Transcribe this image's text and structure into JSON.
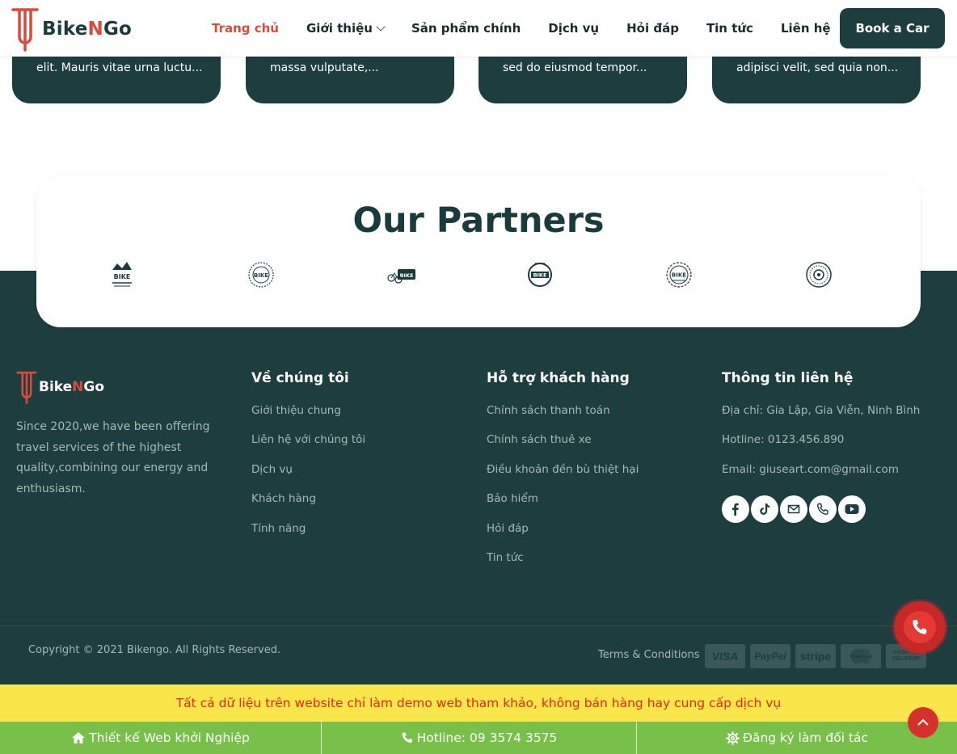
{
  "header": {
    "brand_left": "Bike",
    "brand_n": "N",
    "brand_right": "Go",
    "nav": [
      {
        "label": "Trang chủ",
        "active": true
      },
      {
        "label": "Giới thiệu",
        "has_dropdown": true
      },
      {
        "label": "Sản phẩm chính"
      },
      {
        "label": "Dịch vụ"
      },
      {
        "label": "Hỏi đáp"
      },
      {
        "label": "Tin tức"
      },
      {
        "label": "Liên hệ"
      }
    ],
    "cta_label": "Book a Car"
  },
  "cards": [
    {
      "text": "elit. Mauris vitae urna luctu..."
    },
    {
      "text": "massa vulputate,..."
    },
    {
      "text": "sed do eiusmod tempor..."
    },
    {
      "text": "adipisci velit, sed quia non..."
    }
  ],
  "partners": {
    "title": "Our Partners",
    "logos": [
      "bike-badge-1",
      "bike-badge-2",
      "bike-badge-3",
      "bike-badge-4",
      "bike-badge-5",
      "gear-badge"
    ],
    "logo_texts": [
      "BIKE",
      "BIKE",
      "BIKE",
      "BIKE",
      "BIKE"
    ]
  },
  "footer": {
    "brand_left": "Bike",
    "brand_n": "N",
    "brand_right": "Go",
    "about": "Since 2020,we have been offering travel services of the highest quality,combining our energy and enthusiasm.",
    "columns": [
      {
        "title": "Về chúng tôi",
        "links": [
          "Giới thiệu chung",
          "Liên hệ với chúng tôi",
          "Dịch vụ",
          "Khách hàng",
          "Tính năng"
        ]
      },
      {
        "title": "Hỗ trợ khách hàng",
        "links": [
          "Chính sách thanh toán",
          "Chính sách thuê xe",
          "Điều khoản đền bù thiệt hại",
          "Bảo hiểm",
          "Hỏi đáp",
          "Tin tức"
        ]
      },
      {
        "title": "Thông tin liên hệ",
        "links": [
          "Địa chỉ: Gia Lập, Gia Viễn, Ninh Bình",
          "Hotline: 0123.456.890",
          "Email: giuseart.com@gmail.com"
        ]
      }
    ],
    "socials": [
      "facebook-icon",
      "tiktok-icon",
      "email-icon",
      "phone-icon",
      "youtube-icon"
    ],
    "copyright": "Copyright © 2021 Bikengo. All Rights Reserved.",
    "terms": "Terms & Conditions",
    "payments": [
      "VISA",
      "PayPal",
      "stripe",
      "MasterCard",
      "CASH ON DELIVERY"
    ]
  },
  "notice": "Tất cả dữ liệu trên website chỉ làm demo web tham khảo, không bán hàng hay cung cấp dịch vụ",
  "bottom_bar": [
    {
      "icon": "home-icon",
      "label": "Thiết kế Web khởi Nghiệp"
    },
    {
      "icon": "phone-icon",
      "label": "Hotline: 09 3574 3575"
    },
    {
      "icon": "gear-icon",
      "label": "Đăng ký làm đối tác"
    }
  ],
  "colors": {
    "primary": "#1e3d3f",
    "accent": "#d64c3c",
    "notice_bg": "#f9e64a",
    "notice_text": "#e5281b",
    "bottom_bar": "#78c04a"
  }
}
